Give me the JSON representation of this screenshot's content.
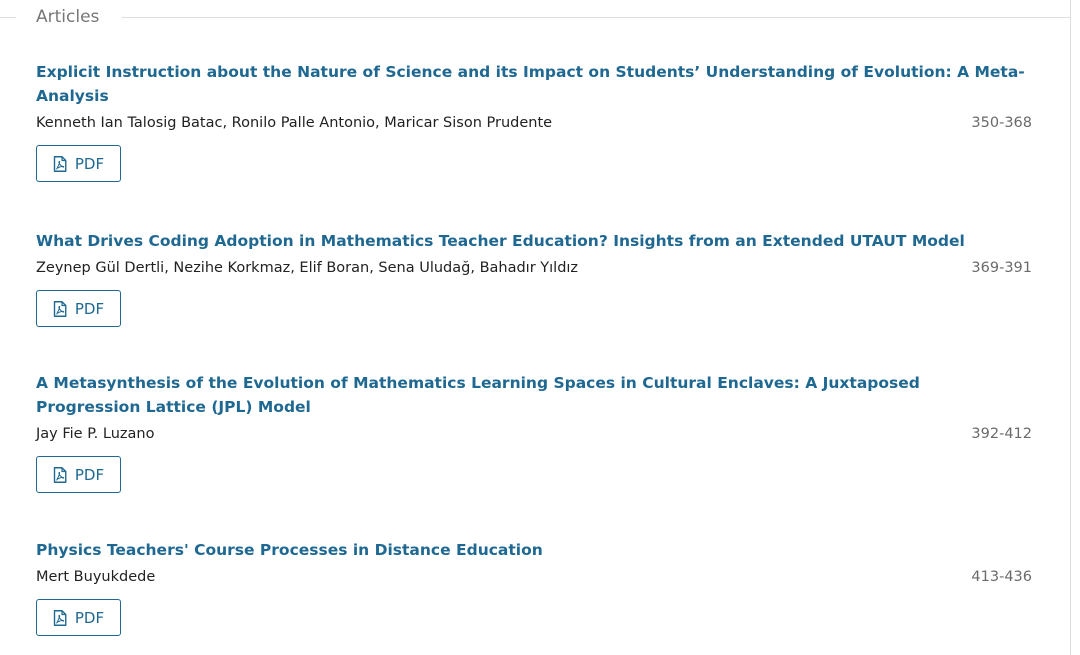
{
  "section": {
    "title": "Articles"
  },
  "articles": [
    {
      "title": "Explicit Instruction about the Nature of Science and its Impact on Students’ Understanding of Evolution: A Meta-Analysis",
      "authors": "Kenneth Ian Talosig Batac, Ronilo Palle Antonio, Maricar Sison Prudente",
      "pages": "350-368",
      "pdf_label": "PDF"
    },
    {
      "title": "What Drives Coding Adoption in Mathematics Teacher Education? Insights from an Extended UTAUT Model",
      "authors": "Zeynep Gül Dertli, Nezihe Korkmaz, Elif Boran, Sena Uludağ, Bahadır Yıldız",
      "pages": "369-391",
      "pdf_label": "PDF"
    },
    {
      "title": "A Metasynthesis of the Evolution of Mathematics Learning Spaces in Cultural Enclaves: A Juxtaposed Progression Lattice (JPL) Model",
      "authors": "Jay Fie P. Luzano",
      "pages": "392-412",
      "pdf_label": "PDF"
    },
    {
      "title": "Physics Teachers' Course Processes in Distance Education",
      "authors": "Mert Buyukdede",
      "pages": "413-436",
      "pdf_label": "PDF"
    }
  ],
  "icons": {
    "pdf": "file-pdf-icon"
  },
  "colors": {
    "link": "#1f6891",
    "section_title": "#777777",
    "pages": "#6a6a6a",
    "divider": "#dddddd"
  }
}
